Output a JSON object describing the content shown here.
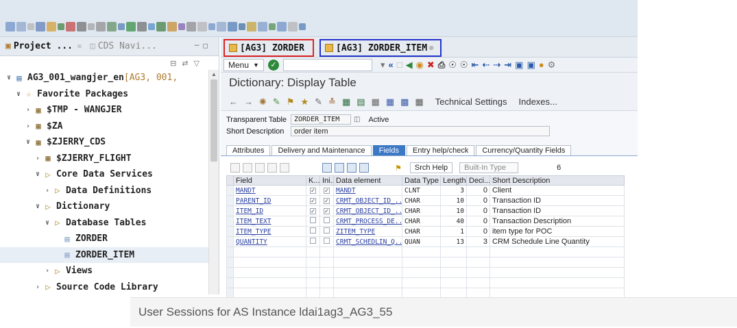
{
  "colors": {
    "accent_red": "#d22222",
    "accent_blue": "#2233cc",
    "active_tab": "#3b78c6"
  },
  "project_panel": {
    "tabs": [
      {
        "label": "Project ...",
        "icon": "project-explorer-icon",
        "close": "☒",
        "active": true
      },
      {
        "label": "CDS Navi...",
        "icon": "cds-navigator-icon",
        "active": false
      }
    ],
    "tree": [
      {
        "label": "AG3_001_wangjer_en",
        "sub": " [AG3, 001,  ",
        "icon": "abap-project-icon",
        "expanded": true,
        "indent": 0
      },
      {
        "label": "Favorite Packages",
        "icon": "star-icon",
        "expanded": true,
        "indent": 1
      },
      {
        "label": "$TMP - WANGJER",
        "icon": "package-icon",
        "expanded": false,
        "indent": 2
      },
      {
        "label": "$ZA",
        "icon": "package-icon",
        "expanded": false,
        "indent": 2
      },
      {
        "label": "$ZJERRY_CDS",
        "icon": "package-icon",
        "expanded": true,
        "indent": 2
      },
      {
        "label": "$ZJERRY_FLIGHT",
        "icon": "package-icon",
        "expanded": false,
        "indent": 3
      },
      {
        "label": "Core Data Services",
        "icon": "folder-icon",
        "expanded": true,
        "indent": 3
      },
      {
        "label": "Data Definitions",
        "icon": "folder-icon",
        "expanded": false,
        "indent": 4
      },
      {
        "label": "Dictionary",
        "icon": "folder-icon",
        "expanded": true,
        "indent": 3
      },
      {
        "label": "Database Tables",
        "icon": "folder-icon",
        "expanded": true,
        "indent": 4
      },
      {
        "label": "ZORDER",
        "icon": "table-icon",
        "expanded": null,
        "indent": 5
      },
      {
        "label": "ZORDER_ITEM",
        "icon": "table-icon",
        "expanded": null,
        "indent": 5,
        "selected": true
      },
      {
        "label": "Views",
        "icon": "folder-icon",
        "expanded": false,
        "indent": 4
      },
      {
        "label": "Source Code Library",
        "icon": "folder-icon",
        "expanded": false,
        "indent": 3
      }
    ]
  },
  "editor": {
    "tabs": [
      {
        "label": "[AG3] ZORDER"
      },
      {
        "label": "[AG3] ZORDER_ITEM"
      }
    ],
    "menu_label": "Menu",
    "title": "Dictionary: Display Table",
    "toolbar_links": [
      "Technical Settings",
      "Indexes..."
    ],
    "header": {
      "table_type_label": "Transparent Table",
      "table_name": "ZORDER_ITEM",
      "status": "Active",
      "short_desc_label": "Short Description",
      "short_desc": "order item"
    },
    "subtabs": [
      "Attributes",
      "Delivery and Maintenance",
      "Fields",
      "Entry help/check",
      "Currency/Quantity Fields"
    ],
    "active_subtab": "Fields",
    "grid_toolbar": {
      "srch_help": "Srch Help",
      "builtin_type": "Built-In Type",
      "count": "6"
    },
    "columns": [
      "Field",
      "K...",
      "Ini...",
      "Data element",
      "Data Type",
      "Length",
      "Deci...",
      "Short Description"
    ],
    "rows": [
      {
        "field": "MANDT",
        "key": true,
        "init": true,
        "dtel": "MANDT",
        "type": "CLNT",
        "length": "3",
        "dec": "0",
        "desc": "Client"
      },
      {
        "field": "PARENT_ID",
        "key": true,
        "init": true,
        "dtel": "CRMT_OBJECT_ID_...",
        "type": "CHAR",
        "length": "10",
        "dec": "0",
        "desc": "Transaction ID"
      },
      {
        "field": "ITEM_ID",
        "key": true,
        "init": true,
        "dtel": "CRMT_OBJECT_ID_...",
        "type": "CHAR",
        "length": "10",
        "dec": "0",
        "desc": "Transaction ID"
      },
      {
        "field": "ITEM_TEXT",
        "key": false,
        "init": false,
        "dtel": "CRMT_PROCESS_DE...",
        "type": "CHAR",
        "length": "40",
        "dec": "0",
        "desc": "Transaction Description"
      },
      {
        "field": "ITEM_TYPE",
        "key": false,
        "init": false,
        "dtel": "ZITEM_TYPE",
        "type": "CHAR",
        "length": "1",
        "dec": "0",
        "desc": "item type for POC"
      },
      {
        "field": "QUANTITY",
        "key": false,
        "init": false,
        "dtel": "CRMT_SCHEDLIN_Q...",
        "type": "QUAN",
        "length": "13",
        "dec": "3",
        "desc": "CRM Schedule Line Quantity"
      }
    ]
  },
  "sessions_title": "User Sessions for AS Instance ldai1ag3_AG3_55"
}
